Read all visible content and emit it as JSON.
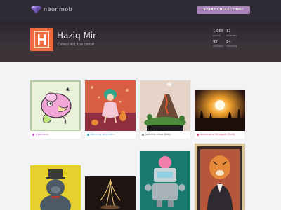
{
  "header": {
    "brand": "neonmob",
    "cta_label": "START COLLECTING!"
  },
  "profile": {
    "name": "Haziq Mir",
    "tagline": "Collect ALL the cards!",
    "avatar_letter": "H",
    "stats": [
      {
        "value": "1,088",
        "label": "points"
      },
      {
        "value": "11",
        "label": "favorites"
      },
      {
        "value": "92",
        "label": "followers"
      },
      {
        "value": "24",
        "label": "following"
      }
    ]
  },
  "cards": [
    {
      "title": "Hideaway",
      "label_color": "#c05bb7"
    },
    {
      "title": "Dancing with Cats",
      "label_color": "#4aa7d8"
    },
    {
      "title": "Volcano Mesa (Day)",
      "label_color": "#7c7c7c"
    },
    {
      "title": "Legendary Smuggle (Gold)",
      "label_color": "#d2446b"
    }
  ],
  "colors": {
    "accent": "#a883b7",
    "header_bg": "#2f2b35",
    "avatar_bg": "#ee6b3f"
  }
}
